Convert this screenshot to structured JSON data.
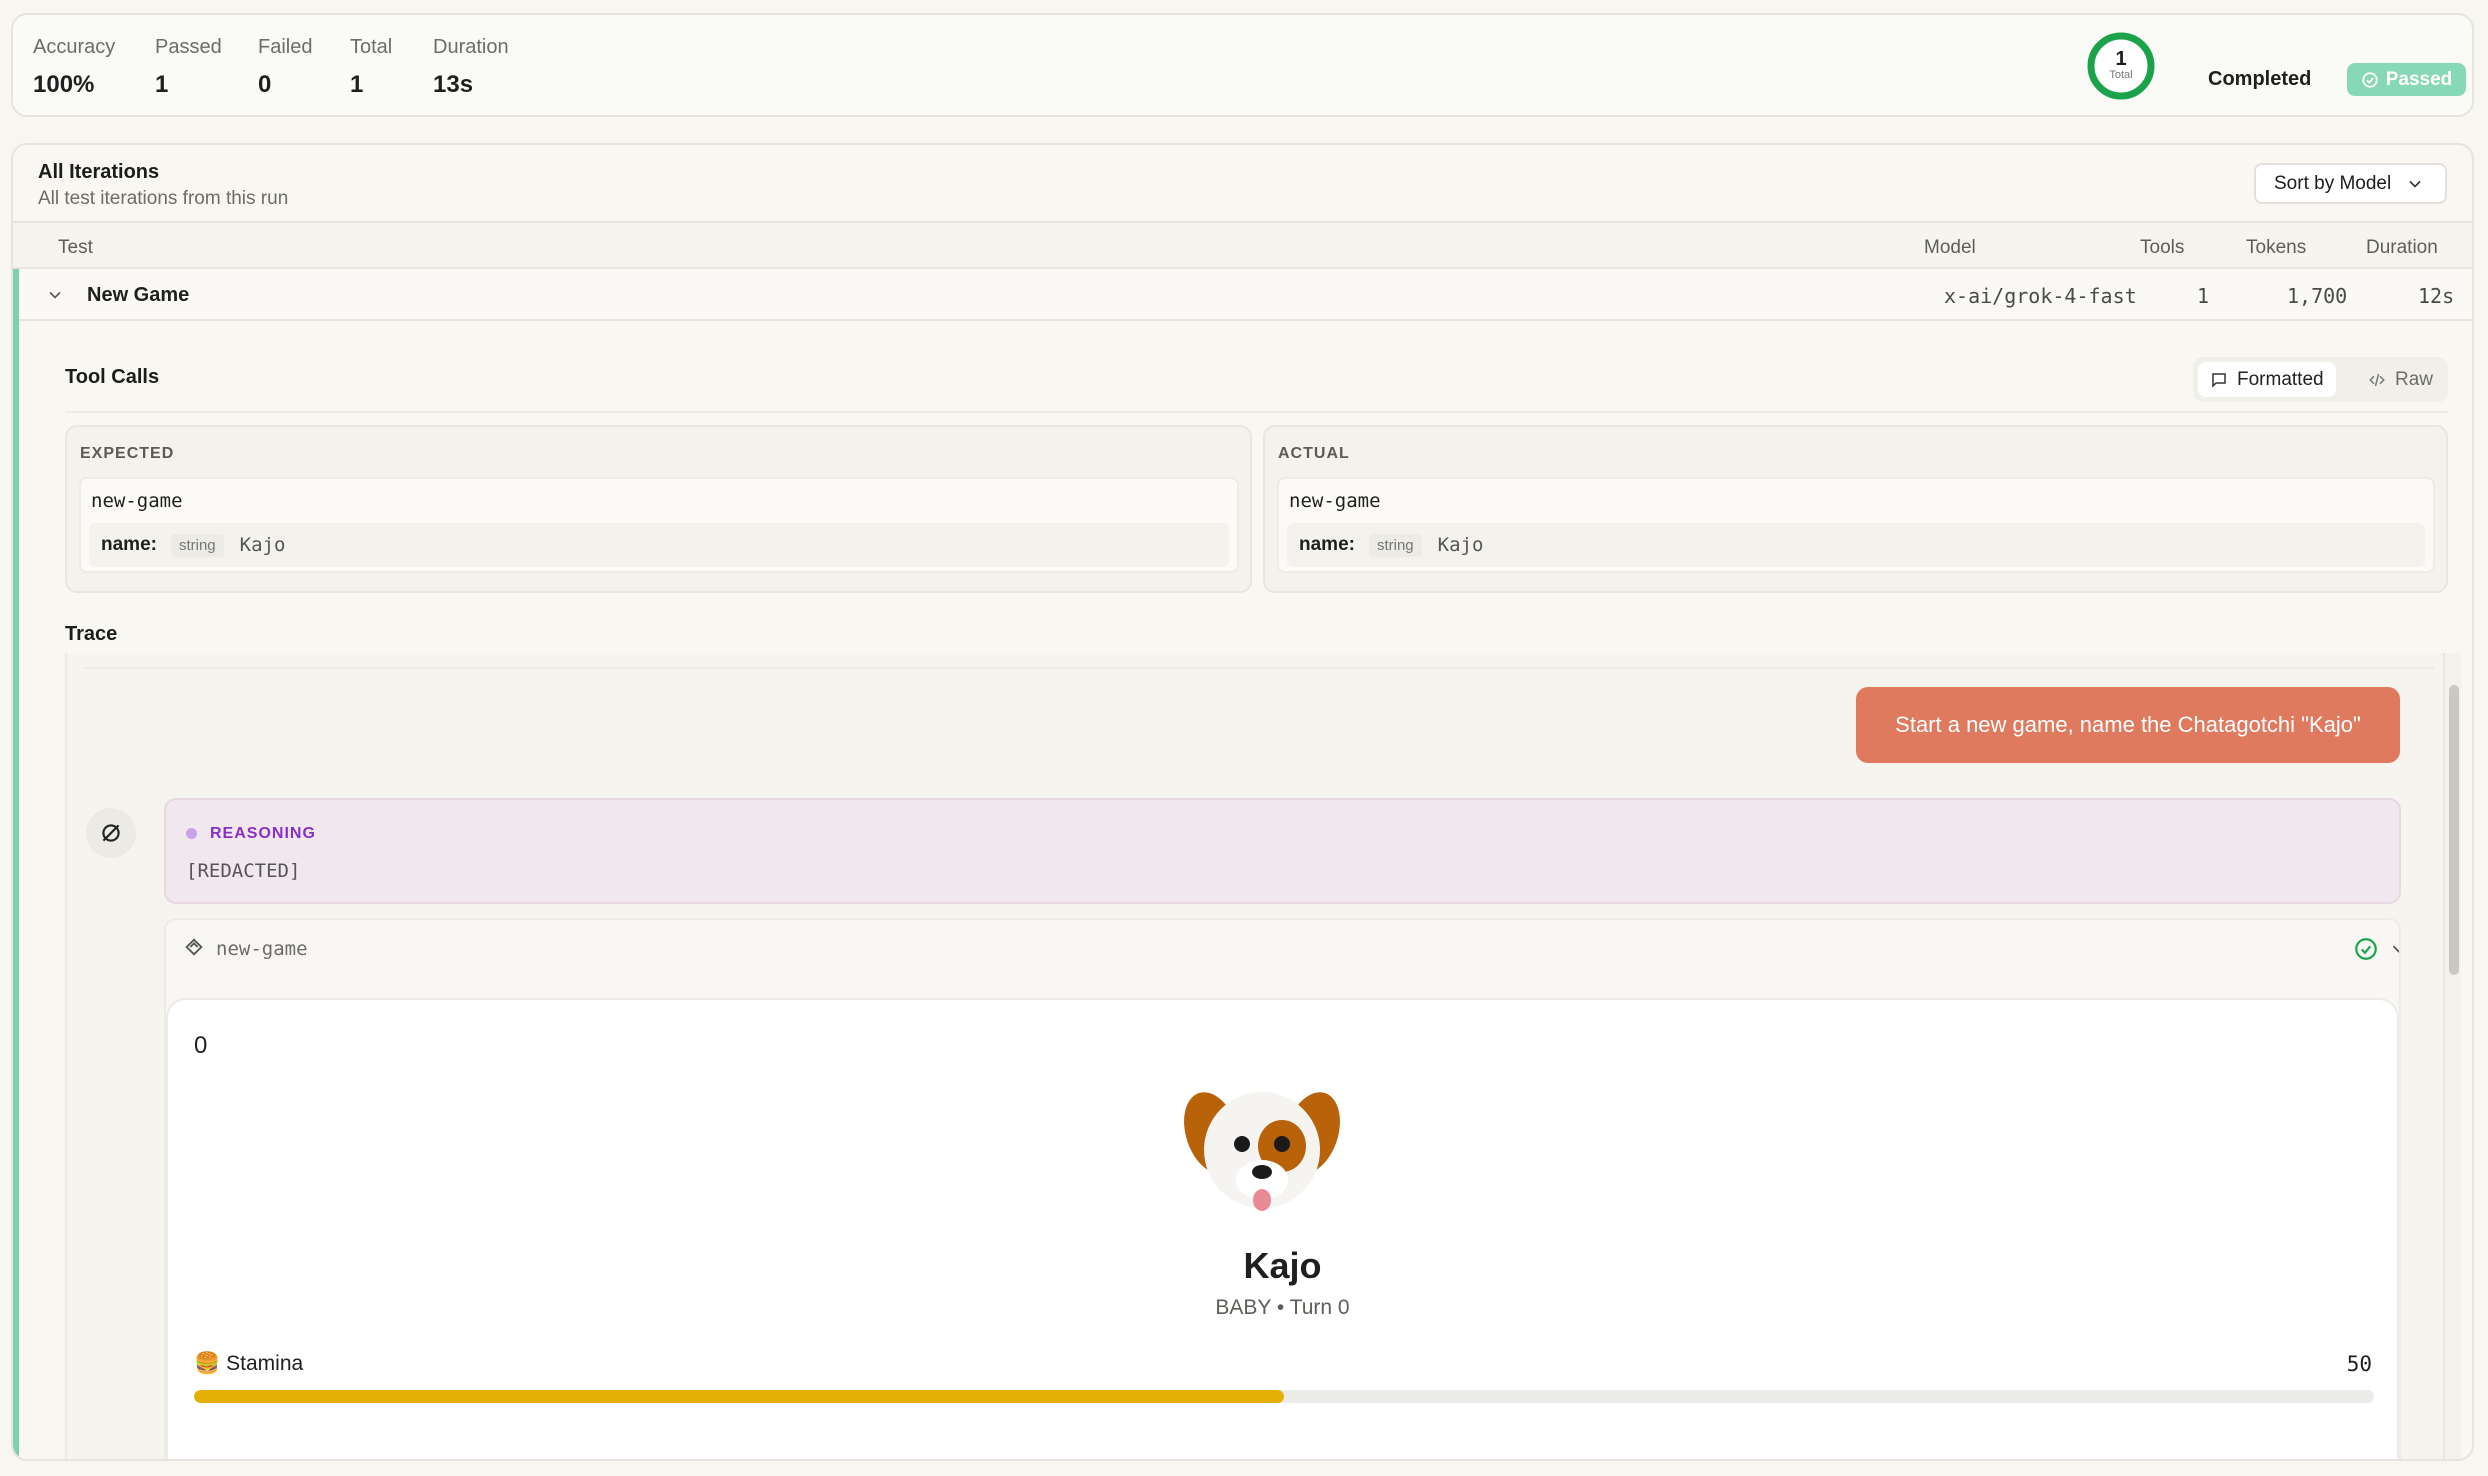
{
  "summary": {
    "stats": [
      {
        "label": "Accuracy",
        "value": "100%"
      },
      {
        "label": "Passed",
        "value": "1"
      },
      {
        "label": "Failed",
        "value": "0"
      },
      {
        "label": "Total",
        "value": "1"
      },
      {
        "label": "Duration",
        "value": "13s"
      }
    ],
    "ring": {
      "number": "1",
      "label": "Total",
      "color": "#1aa34a"
    },
    "status": "Completed",
    "badge": "Passed",
    "badge_color": "#86d9b4"
  },
  "iterations": {
    "title": "All Iterations",
    "subtitle": "All test iterations from this run",
    "sort_label": "Sort by Model",
    "columns": {
      "test": "Test",
      "model": "Model",
      "tools": "Tools",
      "tokens": "Tokens",
      "duration": "Duration"
    },
    "row": {
      "name": "New Game",
      "model": "x-ai/grok-4-fast",
      "tools": "1",
      "tokens": "1,700",
      "duration": "12s"
    }
  },
  "tool_calls": {
    "title": "Tool Calls",
    "toggle": {
      "formatted": "Formatted",
      "raw": "Raw"
    },
    "expected": {
      "label": "EXPECTED",
      "fn": "new-game",
      "arg_name": "name:",
      "arg_type": "string",
      "arg_value": "Kajo"
    },
    "actual": {
      "label": "ACTUAL",
      "fn": "new-game",
      "arg_name": "name:",
      "arg_type": "string",
      "arg_value": "Kajo"
    }
  },
  "trace": {
    "title": "Trace",
    "user_message": "Start a new game, name the Chatagotchi \"Kajo\"",
    "user_bubble_color": "#e07a5f",
    "reasoning_label": "REASONING",
    "reasoning_body": "[REDACTED]",
    "tool_name": "new-game",
    "widget": {
      "counter": "0",
      "pet_name": "Kajo",
      "stage": "BABY • Turn 0",
      "stat_icon": "🍔",
      "stat_label": "Stamina",
      "stat_value": "50",
      "stat_fill": 0.5,
      "stat_color": "#e5b005"
    }
  },
  "icons": {
    "ring": "progress-ring-icon",
    "badge": "check-circle-icon",
    "sort": "chevron-down-icon",
    "row": "chevron-down-icon",
    "formatted": "message-square-icon",
    "raw": "code-icon",
    "avatar": "model-logo-icon",
    "tool": "tool-icon",
    "tool_status": "check-circle-icon",
    "tool_toggle": "chevron-down-icon",
    "pet": "dog-face-icon"
  }
}
